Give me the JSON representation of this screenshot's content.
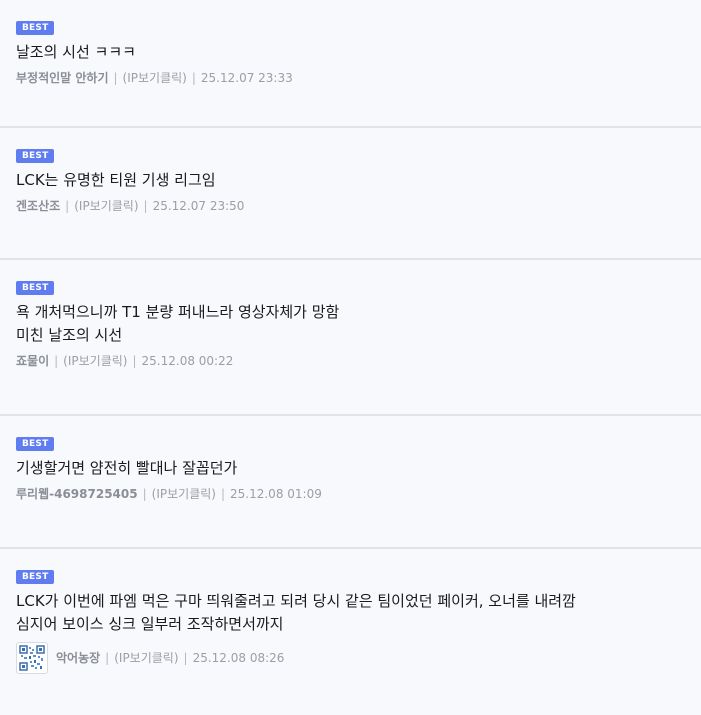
{
  "badge_label": "BEST",
  "comments": [
    {
      "text": "날조의 시선 ㅋㅋㅋ",
      "author": "부정적인말 안하기",
      "ip_label": "(IP보기클릭)",
      "date": "25.12.07 23:33",
      "separator": "|"
    },
    {
      "text": "LCK는 유명한 티원 기생 리그임",
      "author": "겐조산조",
      "ip_label": "(IP보기클릭)",
      "date": "25.12.07 23:50",
      "separator": "|"
    },
    {
      "text": "욕 개처먹으니까 T1 분량 퍼내느라 영상자체가 망함\n미친 날조의 시선",
      "author": "죠물이",
      "ip_label": "(IP보기클릭)",
      "date": "25.12.08 00:22",
      "separator": "|"
    },
    {
      "text": "기생할거면 얌전히 빨대나 잘꼽던가",
      "author": "루리웹-4698725405",
      "ip_label": "(IP보기클릭)",
      "date": "25.12.08 01:09",
      "separator": "|"
    },
    {
      "text": "LCK가 이번에 파엠 먹은 구마 띄워줄려고 되려 당시 같은 팀이었던 페이커, 오너를 내려깜\n심지어 보이스 싱크 일부러 조작하면서까지",
      "author": "악어농장",
      "ip_label": "(IP보기클릭)",
      "date": "25.12.08 08:26",
      "separator": "|",
      "avatar_icon": "qr-code-avatar-icon"
    }
  ],
  "colors": {
    "badge": "#5f7cf0",
    "background": "#f8f9fc",
    "divider": "#e1e3e8",
    "text": "#1a1a1a",
    "meta": "#9a9ea6"
  }
}
